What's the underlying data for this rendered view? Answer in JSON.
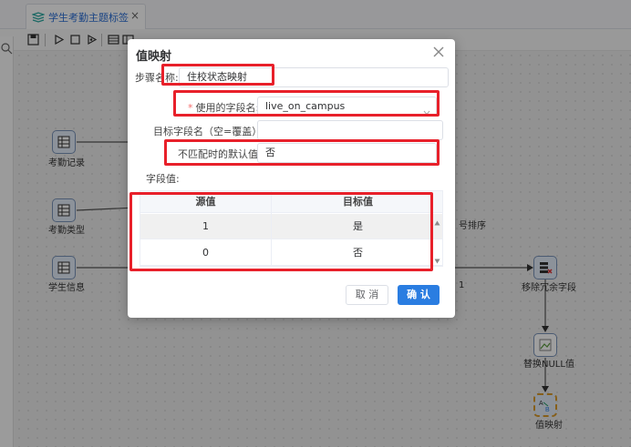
{
  "tab": {
    "title": "学生考勤主题标签",
    "close": "×"
  },
  "canvas": {
    "nodes": {
      "attendance_record": "考勤记录",
      "attendance_type": "考勤类型",
      "student_info": "学生信息",
      "remove_redundant_fields": "移除冗余字段",
      "replace_null": "替换NULL值",
      "value_mapper": "值映射"
    },
    "partial_labels": {
      "sort": "号排序",
      "one": "1"
    },
    "icons": {
      "table": "table-icon",
      "broken_image": "broken-image-icon",
      "mapper": "ab-mapper-icon"
    }
  },
  "dialog": {
    "title": "值映射",
    "step_name_label": "步骤名称:",
    "step_name_value": "住校状态映射",
    "field_name_required": "*",
    "field_name_label": "使用的字段名:",
    "field_name_value": "live_on_campus",
    "target_field_label": "目标字段名（空=覆盖）:",
    "target_field_value": "",
    "default_label": "不匹配时的默认值:",
    "default_value": "否",
    "field_values_label": "字段值:",
    "table": {
      "headers": [
        "源值",
        "目标值"
      ],
      "rows": [
        {
          "source": "1",
          "target": "是"
        },
        {
          "source": "0",
          "target": "否"
        }
      ]
    },
    "cancel": "取 消",
    "confirm": "确 认"
  },
  "colors": {
    "primary": "#2a7de1",
    "highlight": "#e8202a",
    "tab_text": "#2b6fd6"
  }
}
